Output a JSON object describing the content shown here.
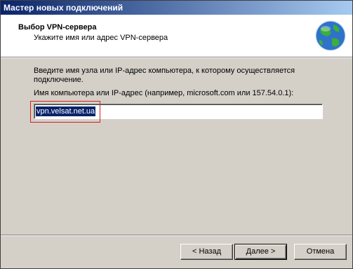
{
  "window": {
    "title": "Мастер новых подключений"
  },
  "header": {
    "title": "Выбор VPN-сервера",
    "subtitle": "Укажите имя или адрес VPN-сервера",
    "icon": "globe-network-icon"
  },
  "body": {
    "description": "Введите имя узла или IP-адрес компьютера, к  которому осуществляется подключение.",
    "field_label": "Имя компьютера или IP-адрес (например, microsoft.com или 157.54.0.1):",
    "field_value": "vpn.velsat.net.ua"
  },
  "buttons": {
    "back": "< Назад",
    "next": "Далее >",
    "cancel": "Отмена"
  },
  "colors": {
    "titlebar_start": "#0a246a",
    "titlebar_end": "#a6caf0",
    "highlight_box": "#d81e1e",
    "dialog_bg": "#d4d0c8"
  }
}
